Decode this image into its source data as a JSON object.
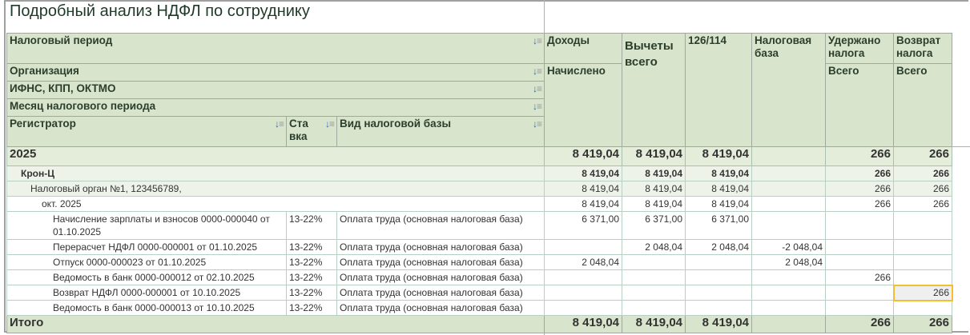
{
  "title": "Подробный анализ НДФЛ по сотруднику",
  "header": {
    "period": "Налоговый период",
    "org": "Организация",
    "ifns": "ИФНС, КПП, ОКТМО",
    "month": "Месяц налогового периода",
    "registrar": "Регистратор",
    "rate": "Ста вка",
    "base_kind": "Вид налоговой базы",
    "income": "Доходы",
    "accrued": "Начислено",
    "deductions": "Вычеты всего",
    "c126": "126/114",
    "tax_base": "Налоговая база",
    "withheld": "Удержано налога",
    "withheld_total": "Всего",
    "refund": "Возврат налога",
    "refund_total": "Всего"
  },
  "groups": {
    "year": {
      "label": "2025",
      "income": "8 419,04",
      "ded": "8 419,04",
      "c126": "8 419,04",
      "base": "",
      "withheld": "266",
      "refund": "266"
    },
    "org": {
      "label": "Крон-Ц",
      "income": "8 419,04",
      "ded": "8 419,04",
      "c126": "8 419,04",
      "base": "",
      "withheld": "266",
      "refund": "266"
    },
    "ifns": {
      "label": "Налоговый орган №1, 123456789,",
      "income": "8 419,04",
      "ded": "8 419,04",
      "c126": "8 419,04",
      "base": "",
      "withheld": "266",
      "refund": "266"
    },
    "month": {
      "label": "окт. 2025",
      "income": "8 419,04",
      "ded": "8 419,04",
      "c126": "8 419,04",
      "base": "",
      "withheld": "266",
      "refund": "266"
    }
  },
  "rows": [
    {
      "doc": "Начисление зарплаты и взносов 0000-000040 от 01.10.2025",
      "rate": "13-22%",
      "kind": "Оплата труда (основная налоговая база)",
      "income": "6 371,00",
      "ded": "6 371,00",
      "c126": "6 371,00",
      "base": "",
      "withheld": "",
      "refund": ""
    },
    {
      "doc": "Перерасчет НДФЛ 0000-000001 от 01.10.2025",
      "rate": "13-22%",
      "kind": "Оплата труда (основная налоговая база)",
      "income": "",
      "ded": "2 048,04",
      "c126": "2 048,04",
      "base": "-2 048,04",
      "withheld": "",
      "refund": ""
    },
    {
      "doc": "Отпуск 0000-000023 от 01.10.2025",
      "rate": "13-22%",
      "kind": "Оплата труда (основная налоговая база)",
      "income": "2 048,04",
      "ded": "",
      "c126": "",
      "base": "2 048,04",
      "withheld": "",
      "refund": ""
    },
    {
      "doc": "Ведомость в банк 0000-000012 от 02.10.2025",
      "rate": "13-22%",
      "kind": "Оплата труда (основная налоговая база)",
      "income": "",
      "ded": "",
      "c126": "",
      "base": "",
      "withheld": "266",
      "refund": ""
    },
    {
      "doc": "Возврат НДФЛ 0000-000001 от 10.10.2025",
      "rate": "13-22%",
      "kind": "Оплата труда (основная налоговая база)",
      "income": "",
      "ded": "",
      "c126": "",
      "base": "",
      "withheld": "",
      "refund": "266"
    },
    {
      "doc": "Ведомость в банк 0000-000013 от 10.10.2025",
      "rate": "13-22%",
      "kind": "Оплата труда (основная налоговая база)",
      "income": "",
      "ded": "",
      "c126": "",
      "base": "",
      "withheld": "",
      "refund": ""
    }
  ],
  "total": {
    "label": "Итого",
    "income": "8 419,04",
    "ded": "8 419,04",
    "c126": "8 419,04",
    "base": "",
    "withheld": "266",
    "refund": "266"
  }
}
